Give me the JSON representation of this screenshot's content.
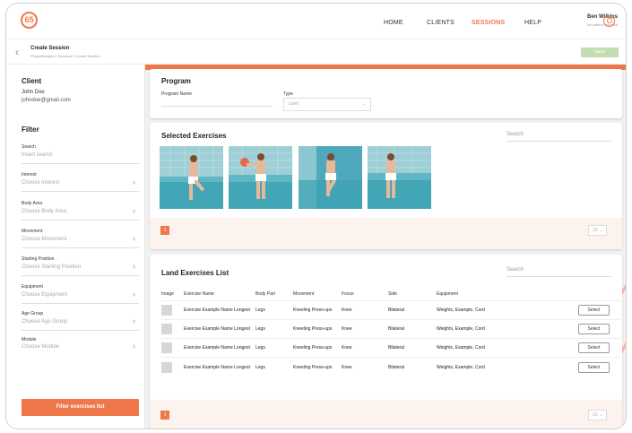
{
  "nav": {
    "items": [
      {
        "label": "HOME",
        "active": false
      },
      {
        "label": "CLIENTS",
        "active": false
      },
      {
        "label": "SESSIONS",
        "active": true
      },
      {
        "label": "HELP",
        "active": false
      }
    ],
    "user_name": "Ben Wilkins",
    "user_sub": "No patient selected",
    "logo_icon": "brand-logo-icon",
    "accent": "#f0774a"
  },
  "subheader": {
    "title": "Create Session",
    "breadcrumb": "Physiotherapist / Sessions / Create Session",
    "save_label": "Save"
  },
  "sidebar": {
    "client_heading": "Client",
    "client_name": "John Doe",
    "client_email": "johndoe@gmail.com",
    "filter_heading": "Filter",
    "search": {
      "label": "Search",
      "placeholder": "Insert search"
    },
    "filters": [
      {
        "label": "Interest",
        "value": "Choose interest"
      },
      {
        "label": "Body Area",
        "value": "Choose Body Area"
      },
      {
        "label": "Movement",
        "value": "Choose Movement"
      },
      {
        "label": "Starting Position",
        "value": "Choose Starting Position"
      },
      {
        "label": "Equipment",
        "value": "Choose Equipment"
      },
      {
        "label": "Age Group",
        "value": "Choose Age Group"
      },
      {
        "label": "Module",
        "value": "Choose Module"
      }
    ],
    "filter_button": "Filter exercises list"
  },
  "program": {
    "heading": "Program",
    "name_label": "Program Name",
    "type_label": "Type",
    "type_value": "Land"
  },
  "selected": {
    "heading": "Selected Exercises",
    "search_placeholder": "Search",
    "page": "1",
    "per_page": "10"
  },
  "land": {
    "heading": "Land Exercises List",
    "search_placeholder": "Search",
    "columns": [
      "Image",
      "Exercise Name",
      "Body Part",
      "Movement",
      "Focus",
      "Side",
      "Equipment"
    ],
    "rows": [
      {
        "name": "Exercise Example Name Longest",
        "body": "Legs",
        "movement": "Kneeling Press-ups",
        "focus": "Knee",
        "side": "Bilateral",
        "equipment": "Weights, Example, Cord",
        "action": "Select"
      },
      {
        "name": "Exercise Example Name Longest",
        "body": "Legs",
        "movement": "Kneeling Press-ups",
        "focus": "Knee",
        "side": "Bilateral",
        "equipment": "Weights, Example, Cord",
        "action": "Select"
      },
      {
        "name": "Exercise Example Name Longest",
        "body": "Legs",
        "movement": "Kneeling Press-ups",
        "focus": "Knee",
        "side": "Bilateral",
        "equipment": "Weights, Example, Cord",
        "action": "Select"
      },
      {
        "name": "Exercise Example Name Longest",
        "body": "Legs",
        "movement": "Kneeling Press-ups",
        "focus": "Knee",
        "side": "Bilateral",
        "equipment": "Weights, Example, Cord",
        "action": "Select"
      }
    ],
    "page": "1",
    "per_page": "10"
  }
}
